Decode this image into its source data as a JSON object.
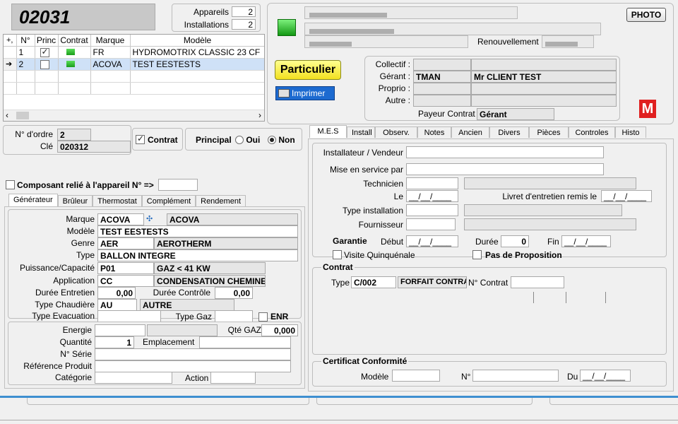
{
  "header": {
    "number": "02031",
    "appareils_label": "Appareils",
    "appareils_value": "2",
    "installations_label": "Installations",
    "installations_value": "2",
    "photo_btn": "PHOTO",
    "renouvellement_label": "Renouvellement"
  },
  "devices": {
    "columns": [
      "N°",
      "Princ",
      "Contrat",
      "Marque",
      "Modèle"
    ],
    "rows": [
      {
        "n": "1",
        "princ": true,
        "marque": "FR",
        "modele": "HYDROMOTRIX CLASSIC 23  CF"
      },
      {
        "n": "2",
        "princ": false,
        "marque": "ACOVA",
        "modele": "TEST EESTESTS"
      }
    ]
  },
  "client": {
    "particulier_btn": "Particulier",
    "imprimer_btn": "Imprimer",
    "collectif_label": "Collectif :",
    "gerant_label": "Gérant :",
    "gerant_code": "TMAN",
    "gerant_name": "Mr CLIENT TEST",
    "proprio_label": "Proprio :",
    "autre_label": "Autre :",
    "payeur_label": "Payeur Contrat",
    "payeur_value": "Gérant",
    "m_badge": "M"
  },
  "order": {
    "ordre_label": "N° d'ordre",
    "ordre_value": "2",
    "cle_label": "Clé",
    "cle_value": "020312",
    "contrat_label": "Contrat",
    "principal_label": "Principal",
    "oui": "Oui",
    "non": "Non",
    "composant_label": "Composant relié à l'appareil N° =>"
  },
  "left_tabs": [
    "Générateur",
    "Brûleur",
    "Thermostat",
    "Complément",
    "Rendement"
  ],
  "gen": {
    "marque_label": "Marque",
    "marque_code": "ACOVA",
    "marque_name": "ACOVA",
    "modele_label": "Modèle",
    "modele_value": "TEST EESTESTS",
    "genre_label": "Genre",
    "genre_code": "AER",
    "genre_name": "AEROTHERM",
    "type_label": "Type",
    "type_value": "BALLON INTEGRE",
    "puissance_label": "Puissance/Capacité",
    "puissance_code": "P01",
    "puissance_name": "GAZ < 41 KW",
    "application_label": "Application",
    "application_code": "CC",
    "application_name": "CONDENSATION CHEMINEE",
    "duree_entretien_label": "Durée Entretien",
    "duree_entretien_value": "0,00",
    "duree_controle_label": "Durée Contrôle",
    "duree_controle_value": "0,00",
    "type_chaudiere_label": "Type Chaudière",
    "type_chaudiere_code": "AU",
    "type_chaudiere_name": "AUTRE",
    "type_evacuation_label": "Type Evacuation",
    "type_gaz_label": "Type Gaz",
    "enr_label": "ENR",
    "energie_label": "Energie",
    "qte_gaz_label": "Qté GAZ",
    "qte_gaz_value": "0,000",
    "quantite_label": "Quantité",
    "quantite_value": "1",
    "emplacement_label": "Emplacement",
    "serie_label": "N° Série",
    "reference_label": "Référence Produit",
    "categorie_label": "Catégorie",
    "action_label": "Action"
  },
  "right_tabs": [
    "M.E.S",
    "Install",
    "Observ.",
    "Notes",
    "Ancien",
    "Divers",
    "Pièces",
    "Controles",
    "Histo"
  ],
  "mes": {
    "installateur_label": "Installateur / Vendeur",
    "mise_label": "Mise en service par",
    "technicien_label": "Technicien",
    "le_label": "Le",
    "date_empty": "__/__/____",
    "livret_label": "Livret d'entretien remis le",
    "type_install_label": "Type installation",
    "fournisseur_label": "Fournisseur",
    "garantie_label": "Garantie",
    "debut_label": "Début",
    "duree_label": "Durée",
    "duree_value": "0",
    "fin_label": "Fin",
    "visite_label": "Visite Quinquénale",
    "pas_label": "Pas de Proposition"
  },
  "contrat": {
    "title": "Contrat",
    "type_label": "Type",
    "type_code": "C/002",
    "type_name": "FORFAIT CONTRAT",
    "n_label": "N° Contrat"
  },
  "certificat": {
    "title": "Certificat Conformité",
    "modele_label": "Modèle",
    "n_label": "N°",
    "du_label": "Du",
    "date_empty": "__/__/____"
  }
}
